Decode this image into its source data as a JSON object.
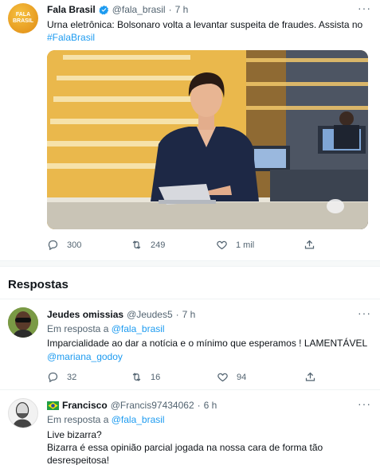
{
  "main_tweet": {
    "author_name": "Fala Brasil",
    "handle": "@fala_brasil",
    "separator": "·",
    "time": "7 h",
    "avatar_text": "FALA BRASIL",
    "text": "Urna eletrônica: Bolsonaro volta a levantar suspeita de fraudes. Assista no",
    "hashtag": "#FalaBrasil",
    "stats": {
      "replies": "300",
      "retweets": "249",
      "likes": "1 mil"
    }
  },
  "section_title": "Respostas",
  "replies": [
    {
      "author_name": "Jeudes omissias",
      "handle": "@Jeudes5",
      "separator": "·",
      "time": "7 h",
      "reply_to_prefix": "Em resposta a",
      "reply_to_handle": "@fala_brasil",
      "text": "Imparcialidade ao dar a notícia e o mínimo que esperamos ! LAMENTÁVEL",
      "mention": "@mariana_godoy",
      "stats": {
        "replies": "32",
        "retweets": "16",
        "likes": "94"
      }
    },
    {
      "author_name": "Francisco",
      "handle": "@Francis97434062",
      "separator": "·",
      "time": "6 h",
      "reply_to_prefix": "Em resposta a",
      "reply_to_handle": "@fala_brasil",
      "line1": "Live bizarra?",
      "line2": "Bizarra é essa opinião parcial jogada na nossa cara de forma tão",
      "line3": "desrespeitosa!"
    }
  ],
  "colors": {
    "link": "#1d9bf0",
    "muted": "#536471",
    "verified": "#1d9bf0",
    "brand_orange": "#e8a11a"
  }
}
